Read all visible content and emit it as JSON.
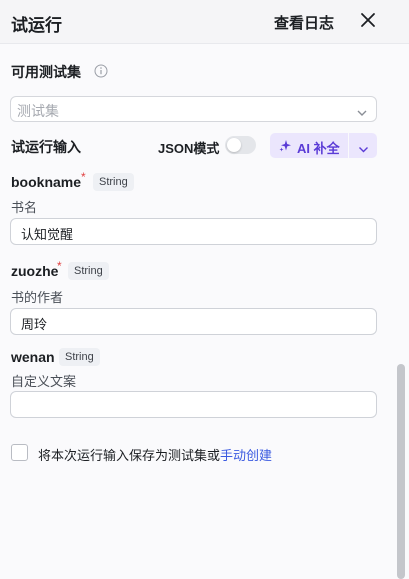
{
  "header": {
    "title": "试运行",
    "view_log": "查看日志"
  },
  "testset": {
    "label": "可用测试集",
    "placeholder": "测试集"
  },
  "run_input": {
    "label": "试运行输入",
    "json_mode_label": "JSON模式",
    "json_mode_on": false,
    "ai_button_label": "AI 补全"
  },
  "fields": [
    {
      "name": "bookname",
      "required": true,
      "type": "String",
      "description": "书名",
      "value": "认知觉醒"
    },
    {
      "name": "zuozhe",
      "required": true,
      "type": "String",
      "description": "书的作者",
      "value": "周玲"
    },
    {
      "name": "wenan",
      "required": false,
      "type": "String",
      "description": "自定义文案",
      "value": ""
    }
  ],
  "footer": {
    "save_text": "将本次运行输入保存为测试集或",
    "manual_link": "手动创建",
    "checked": false
  },
  "colors": {
    "accent": "#5a3bd6",
    "ai_bg": "#ebe6fd",
    "link": "#3c5be0",
    "required": "#e04040"
  }
}
